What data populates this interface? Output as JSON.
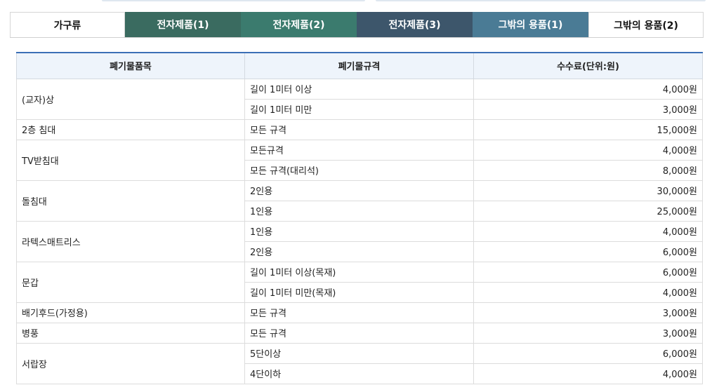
{
  "tabs": [
    {
      "label": "가구류",
      "active": true
    },
    {
      "label": "전자제품(1)"
    },
    {
      "label": "전자제품(2)"
    },
    {
      "label": "전자제품(3)"
    },
    {
      "label": "그밖의 용품(1)"
    },
    {
      "label": "그밖의 용품(2)"
    }
  ],
  "table": {
    "headers": [
      "폐기물품목",
      "폐기물규격",
      "수수료(단위:원)"
    ],
    "items": [
      {
        "name": "(교자)상",
        "rows": [
          {
            "spec": "길이 1미터 이상",
            "fee": "4,000원"
          },
          {
            "spec": "길이 1미터 미만",
            "fee": "3,000원"
          }
        ]
      },
      {
        "name": "2층 침대",
        "rows": [
          {
            "spec": "모든 규격",
            "fee": "15,000원"
          }
        ]
      },
      {
        "name": "TV받침대",
        "rows": [
          {
            "spec": "모든규격",
            "fee": "4,000원"
          },
          {
            "spec": "모든 규격(대리석)",
            "fee": "8,000원"
          }
        ]
      },
      {
        "name": "돌침대",
        "rows": [
          {
            "spec": "2인용",
            "fee": "30,000원"
          },
          {
            "spec": "1인용",
            "fee": "25,000원"
          }
        ]
      },
      {
        "name": "라텍스매트리스",
        "rows": [
          {
            "spec": "1인용",
            "fee": "4,000원"
          },
          {
            "spec": "2인용",
            "fee": "6,000원"
          }
        ]
      },
      {
        "name": "문갑",
        "rows": [
          {
            "spec": "길이 1미터 이상(목재)",
            "fee": "6,000원"
          },
          {
            "spec": "길이 1미터 미만(목재)",
            "fee": "4,000원"
          }
        ]
      },
      {
        "name": "배기후드(가정용)",
        "rows": [
          {
            "spec": "모든 규격",
            "fee": "3,000원"
          }
        ]
      },
      {
        "name": "병풍",
        "rows": [
          {
            "spec": "모든 규격",
            "fee": "3,000원"
          }
        ]
      },
      {
        "name": "서랍장",
        "rows": [
          {
            "spec": "5단이상",
            "fee": "6,000원"
          },
          {
            "spec": "4단이하",
            "fee": "4,000원"
          }
        ]
      }
    ]
  }
}
